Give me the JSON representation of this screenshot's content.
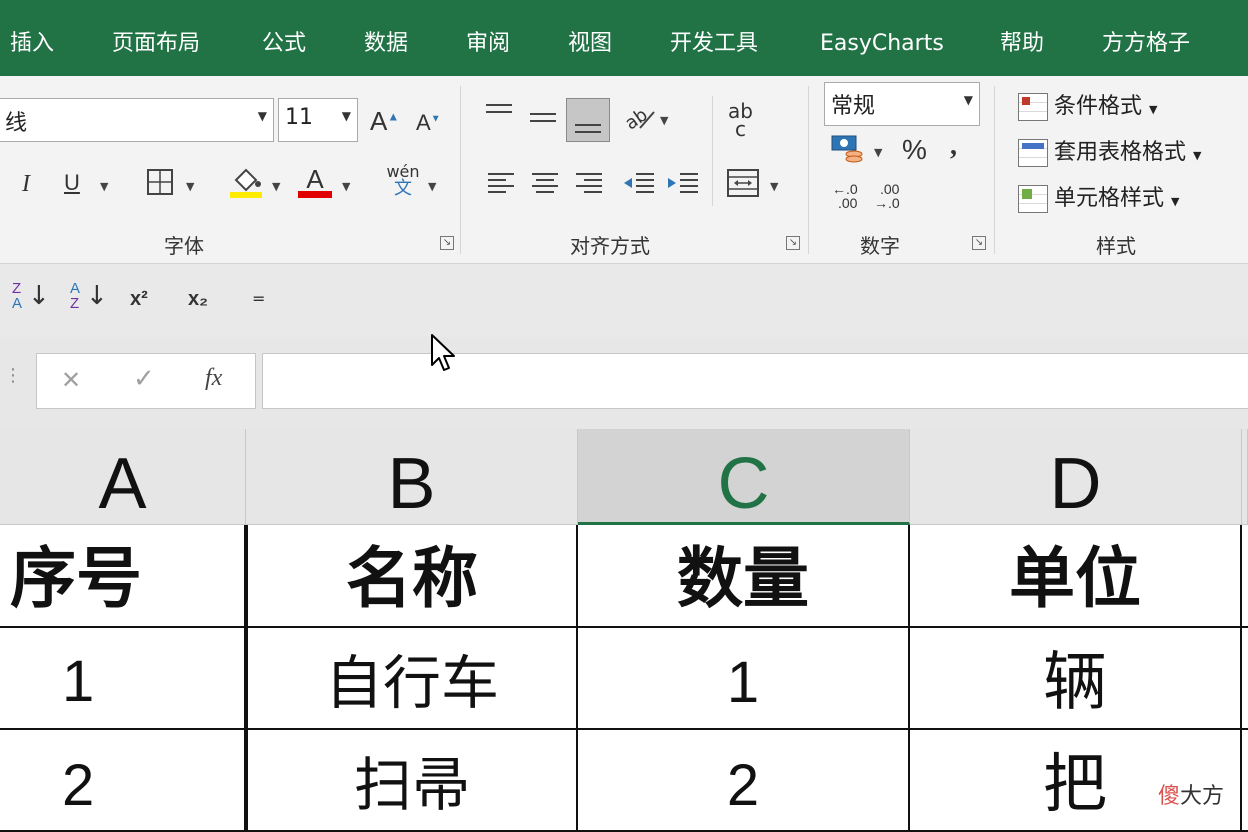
{
  "tabs": [
    "插入",
    "页面布局",
    "公式",
    "数据",
    "审阅",
    "视图",
    "开发工具",
    "EasyCharts",
    "帮助",
    "方方格子"
  ],
  "font_group": {
    "font_name_partial": "线",
    "font_size": "11",
    "grow_label": "A",
    "shrink_label": "A",
    "italic_label": "I",
    "underline_label": "U",
    "font_color_label": "A",
    "phonetic_top": "wén",
    "phonetic_bottom": "文",
    "label": "字体"
  },
  "align_group": {
    "label": "对齐方式"
  },
  "wrap_icon_text": {
    "top": "ab",
    "bottom": "c"
  },
  "number_group": {
    "format": "常规",
    "percent": "%",
    "comma": ",",
    "inc_decimal_top": "←.0",
    "inc_decimal_bottom": ".00",
    "dec_decimal_top": ".00",
    "dec_decimal_bottom": "→.0",
    "label": "数字"
  },
  "styles_group": {
    "conditional": "条件格式",
    "table_format": "套用表格格式",
    "cell_styles": "单元格样式",
    "label": "样式"
  },
  "mini_toolbar": {
    "sort_az_top": "Z",
    "sort_az_bottom": "A",
    "sort_za_top": "A",
    "sort_za_bottom": "Z",
    "superscript": "x²",
    "subscript": "x₂",
    "more": "="
  },
  "formula_bar": {
    "cancel": "✕",
    "enter": "✓",
    "fx": "fx",
    "value": ""
  },
  "columns": [
    "A",
    "B",
    "C",
    "D"
  ],
  "selected_column": "C",
  "table": {
    "headers": [
      "序号",
      "名称",
      "数量",
      "单位"
    ],
    "rows": [
      [
        "1",
        "自行车",
        "1",
        "辆"
      ],
      [
        "2",
        "扫帚",
        "2",
        "把"
      ]
    ]
  },
  "watermark": {
    "part1": "傻",
    "part2": "大方"
  },
  "colors": {
    "ribbon_green": "#217346",
    "selected_header": "#d3d3d3"
  }
}
